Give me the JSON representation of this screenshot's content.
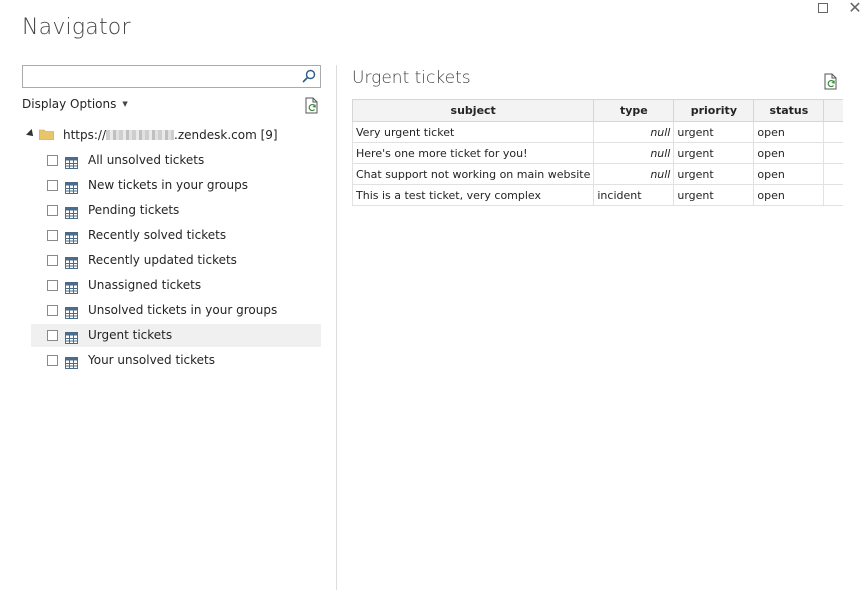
{
  "window": {
    "title": "Navigator",
    "close_glyph": "✕"
  },
  "search": {
    "value": "",
    "placeholder": ""
  },
  "display_options": {
    "label": "Display Options",
    "caret": "▼"
  },
  "tree": {
    "root": {
      "prefix": "https://",
      "suffix": ".zendesk.com [9]"
    },
    "items": [
      {
        "label": "All unsolved tickets",
        "checked": false
      },
      {
        "label": "New tickets in your groups",
        "checked": false
      },
      {
        "label": "Pending tickets",
        "checked": false
      },
      {
        "label": "Recently solved tickets",
        "checked": false
      },
      {
        "label": "Recently updated tickets",
        "checked": false
      },
      {
        "label": "Unassigned tickets",
        "checked": false
      },
      {
        "label": "Unsolved tickets in your groups",
        "checked": false
      },
      {
        "label": "Urgent tickets",
        "checked": false,
        "selected": true
      },
      {
        "label": "Your unsolved tickets",
        "checked": false
      }
    ]
  },
  "preview": {
    "title": "Urgent tickets",
    "columns": [
      "subject",
      "type",
      "priority",
      "status"
    ],
    "rows": [
      [
        "Very urgent ticket",
        "null",
        "urgent",
        "open"
      ],
      [
        "Here's one more ticket for you!",
        "null",
        "urgent",
        "open"
      ],
      [
        "Chat support not working on main website",
        "null",
        "urgent",
        "open"
      ],
      [
        "This is a test ticket, very complex",
        "incident",
        "urgent",
        "open"
      ]
    ]
  },
  "icons": {
    "search": "search-icon",
    "refresh": "refresh-icon",
    "folder": "folder-icon",
    "table": "table-icon"
  },
  "colors": {
    "folder": "#e8c46a",
    "selected_row": "#f0f0f0",
    "table_icon": "#4a6b8a"
  }
}
